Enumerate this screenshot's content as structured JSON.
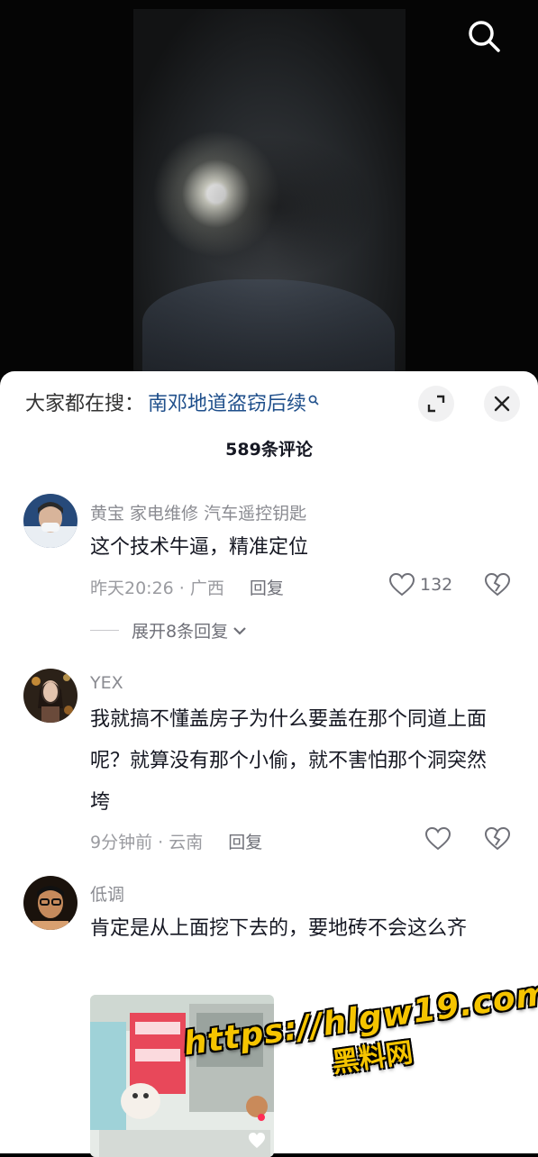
{
  "trending": {
    "label": "大家都在搜：",
    "query": "南邓地道盗窃后续"
  },
  "comments_header": {
    "count": "589条评论"
  },
  "comments": [
    {
      "name": "黄宝 家电维修 汽车遥控钥匙",
      "text": "这个技术牛逼，精准定位",
      "time_location": "昨天20:26 · 广西",
      "reply_label": "回复",
      "likes": "132",
      "expand_label": "展开8条回复"
    },
    {
      "name": "YEX",
      "text": "我就搞不懂盖房子为什么要盖在那个同道上面呢？就算没有那个小偷，就不害怕那个洞突然垮",
      "time_location": "9分钟前 · 云南",
      "reply_label": "回复"
    },
    {
      "name": "低调",
      "text": "肯定是从上面挖下去的，要地砖不会这么齐"
    }
  ],
  "watermark": {
    "url": "https://hlgw19.com",
    "site": "黑料网"
  },
  "colors": {
    "link": "#1f4f8b",
    "watermark": "#f5c400"
  }
}
